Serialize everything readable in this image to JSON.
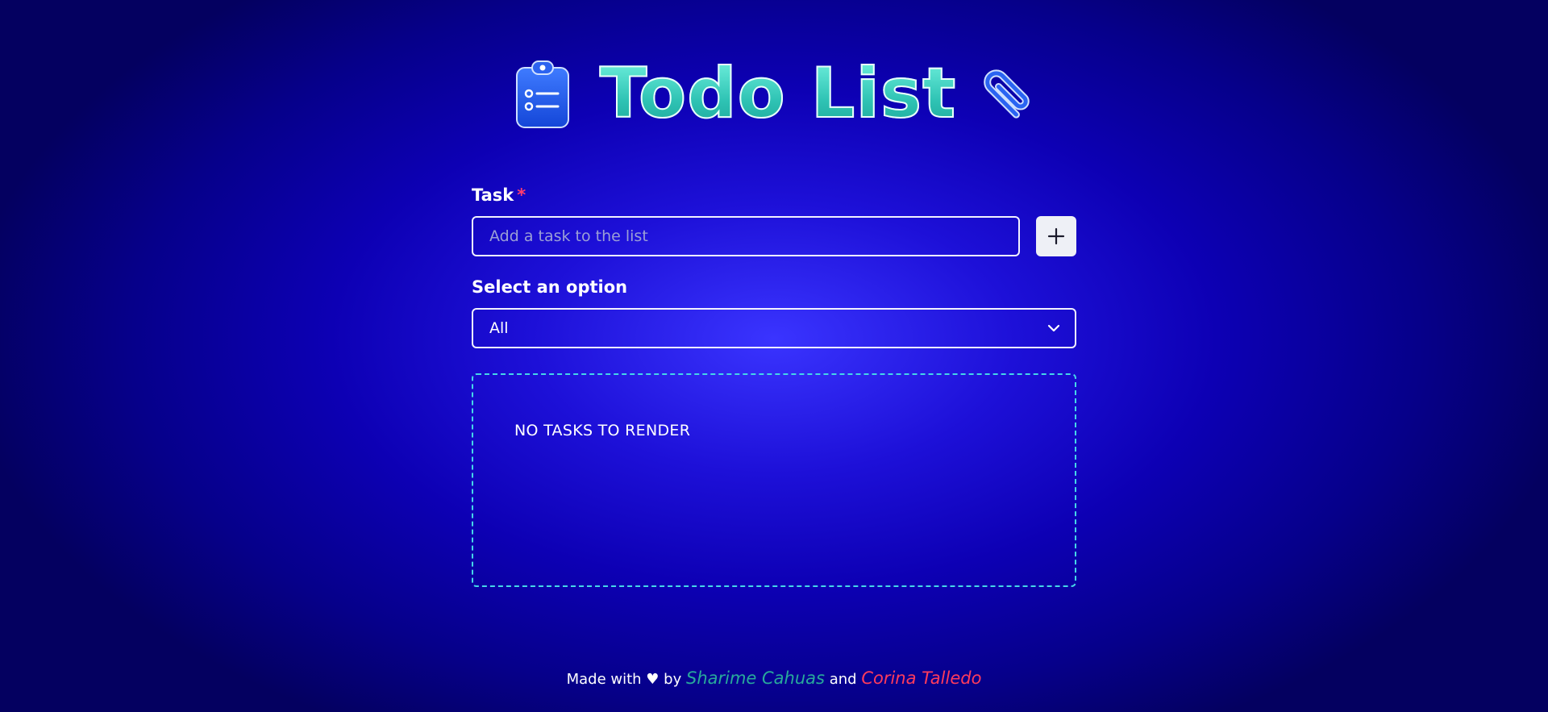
{
  "header": {
    "title": "Todo List",
    "left_icon": "clipboard-list-icon",
    "right_icon": "paperclip-icon"
  },
  "form": {
    "task_label": "Task",
    "required_mark": "*",
    "task_placeholder": "Add a task to the list",
    "task_value": "",
    "add_icon": "plus-icon",
    "select_label": "Select an option",
    "select_value": "All",
    "select_icon": "chevron-down-icon"
  },
  "tasks": {
    "items": [],
    "empty_message": "NO TASKS TO RENDER"
  },
  "footer": {
    "prefix": "Made with",
    "heart": "♥",
    "by": "by",
    "author_1": "Sharime Cahuas",
    "and": "and",
    "author_2": "Corina Talledo"
  },
  "colors": {
    "accent_teal": "#45d6c4",
    "required_red": "#ff3d6e",
    "dashed_border": "#45d6e8",
    "author_1_color": "#28a99b",
    "author_2_color": "#ff3b5c"
  }
}
